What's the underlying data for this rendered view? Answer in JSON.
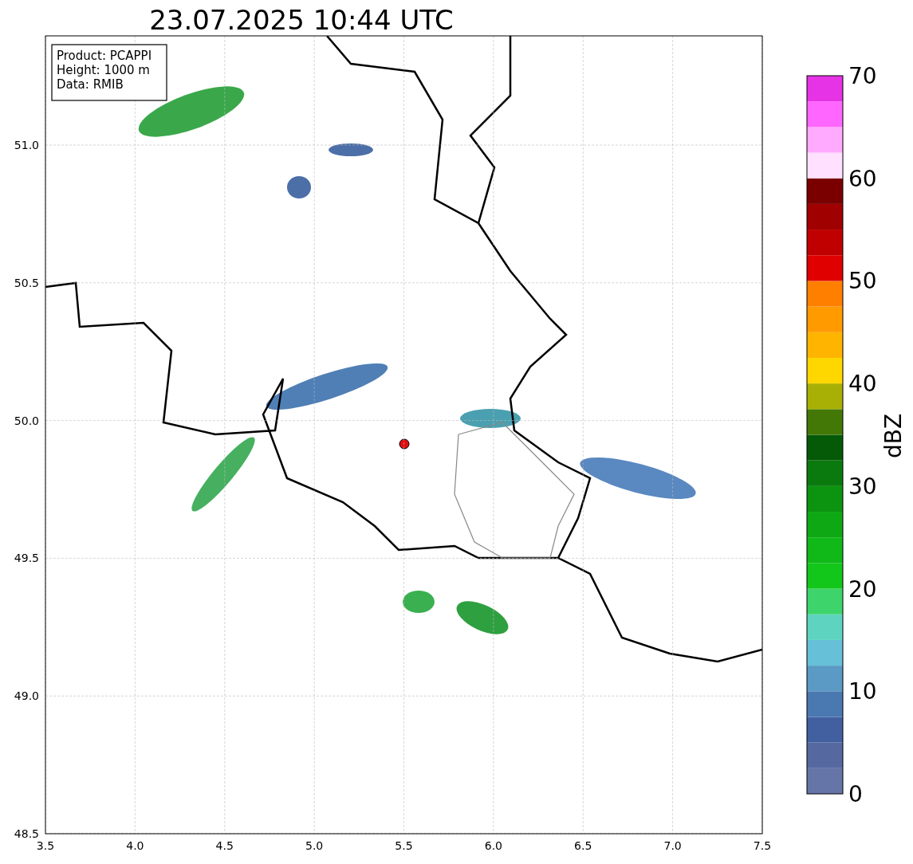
{
  "title": "23.07.2025 10:44 UTC",
  "map": {
    "xticks": [
      "3.5",
      "4.0",
      "4.5",
      "5.0",
      "5.5",
      "6.0",
      "6.5",
      "7.0",
      "7.5"
    ],
    "yticks": [
      "51.0",
      "50.5",
      "50.0",
      "49.5",
      "49.0",
      "48.5"
    ],
    "legend": [
      "Product: PCAPPI",
      "Height: 1000 m",
      "Data: RMIB"
    ]
  },
  "colorbar": {
    "label": "dBZ",
    "ticks": [
      "70",
      "60",
      "50",
      "40",
      "30",
      "20",
      "10",
      "0"
    ],
    "bands": [
      {
        "color": "#6575a8"
      },
      {
        "color": "#5569a0"
      },
      {
        "color": "#4260a0"
      },
      {
        "color": "#4a78b0"
      },
      {
        "color": "#5a9ac4"
      },
      {
        "color": "#65c0d8"
      },
      {
        "color": "#5ed4c0"
      },
      {
        "color": "#3dd46c"
      },
      {
        "color": "#12c71a"
      },
      {
        "color": "#10b818"
      },
      {
        "color": "#0ea814"
      },
      {
        "color": "#0c9410"
      },
      {
        "color": "#0a7a0e"
      },
      {
        "color": "#055a08"
      },
      {
        "color": "#437807"
      },
      {
        "color": "#a9b005"
      },
      {
        "color": "#ffd700"
      },
      {
        "color": "#ffb400"
      },
      {
        "color": "#ff9a00"
      },
      {
        "color": "#ff7f00"
      },
      {
        "color": "#e00000"
      },
      {
        "color": "#c00000"
      },
      {
        "color": "#a00000"
      },
      {
        "color": "#7a0000"
      },
      {
        "color": "#ffe0ff"
      },
      {
        "color": "#ffaaff"
      },
      {
        "color": "#ff66ff"
      },
      {
        "color": "#e633e6"
      }
    ]
  }
}
